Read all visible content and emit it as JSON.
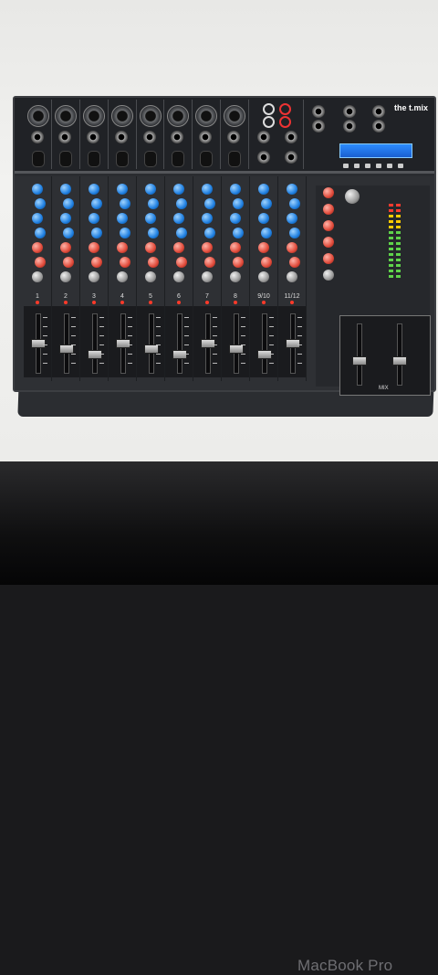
{
  "photo": {
    "description_scene": "mixer-on-screen",
    "laptop_label": "MacBook Pro",
    "mixer_brand_text": "the t.mix",
    "channel_numbers": [
      "1",
      "2",
      "3",
      "4",
      "5",
      "6",
      "7",
      "8",
      "9/10",
      "11/12"
    ],
    "master_label": "MIX",
    "colors": {
      "screen_bg": "#ececea",
      "mixer_body": "#2e3034",
      "knob_blue": "#1f7fe0",
      "knob_red": "#e04a3a",
      "display_blue": "#2c8cff",
      "bezel": "#0f0f10"
    }
  }
}
